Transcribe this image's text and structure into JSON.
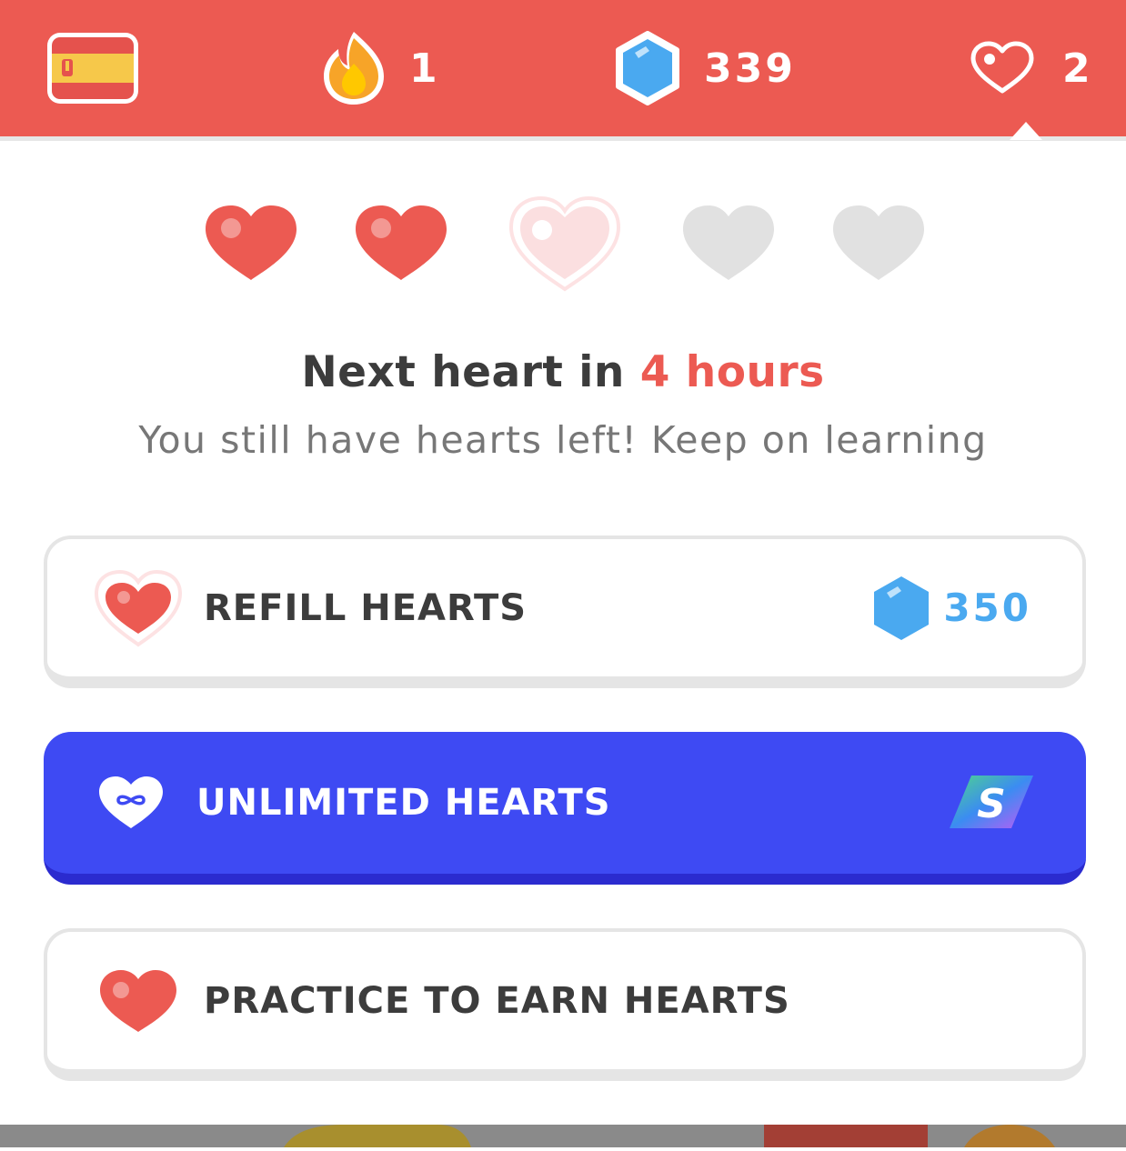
{
  "header": {
    "course_flag_icon": "spain-flag-icon",
    "streak": {
      "icon": "flame-icon",
      "value": "1"
    },
    "gems": {
      "icon": "gem-icon",
      "value": "339"
    },
    "hearts": {
      "icon": "heart-outline-icon",
      "value": "2"
    }
  },
  "hearts_panel": {
    "hearts": [
      {
        "state": "full"
      },
      {
        "state": "full"
      },
      {
        "state": "refilling"
      },
      {
        "state": "empty"
      },
      {
        "state": "empty"
      }
    ],
    "next_heart_prefix": "Next heart in ",
    "next_heart_time": "4 hours",
    "subtext": "You still have hearts left! Keep on learning"
  },
  "options": {
    "refill": {
      "label": "REFILL HEARTS",
      "price": "350",
      "price_icon": "gem-icon"
    },
    "unlimited": {
      "label": "UNLIMITED HEARTS",
      "badge_icon": "super-s-icon"
    },
    "practice": {
      "label": "PRACTICE TO EARN HEARTS"
    }
  },
  "colors": {
    "brand_red": "#ec5a52",
    "button_blue": "#3e4af3",
    "gem_blue": "#4aa9f0",
    "text_dark": "#3c3c3c",
    "text_muted": "#777777"
  }
}
